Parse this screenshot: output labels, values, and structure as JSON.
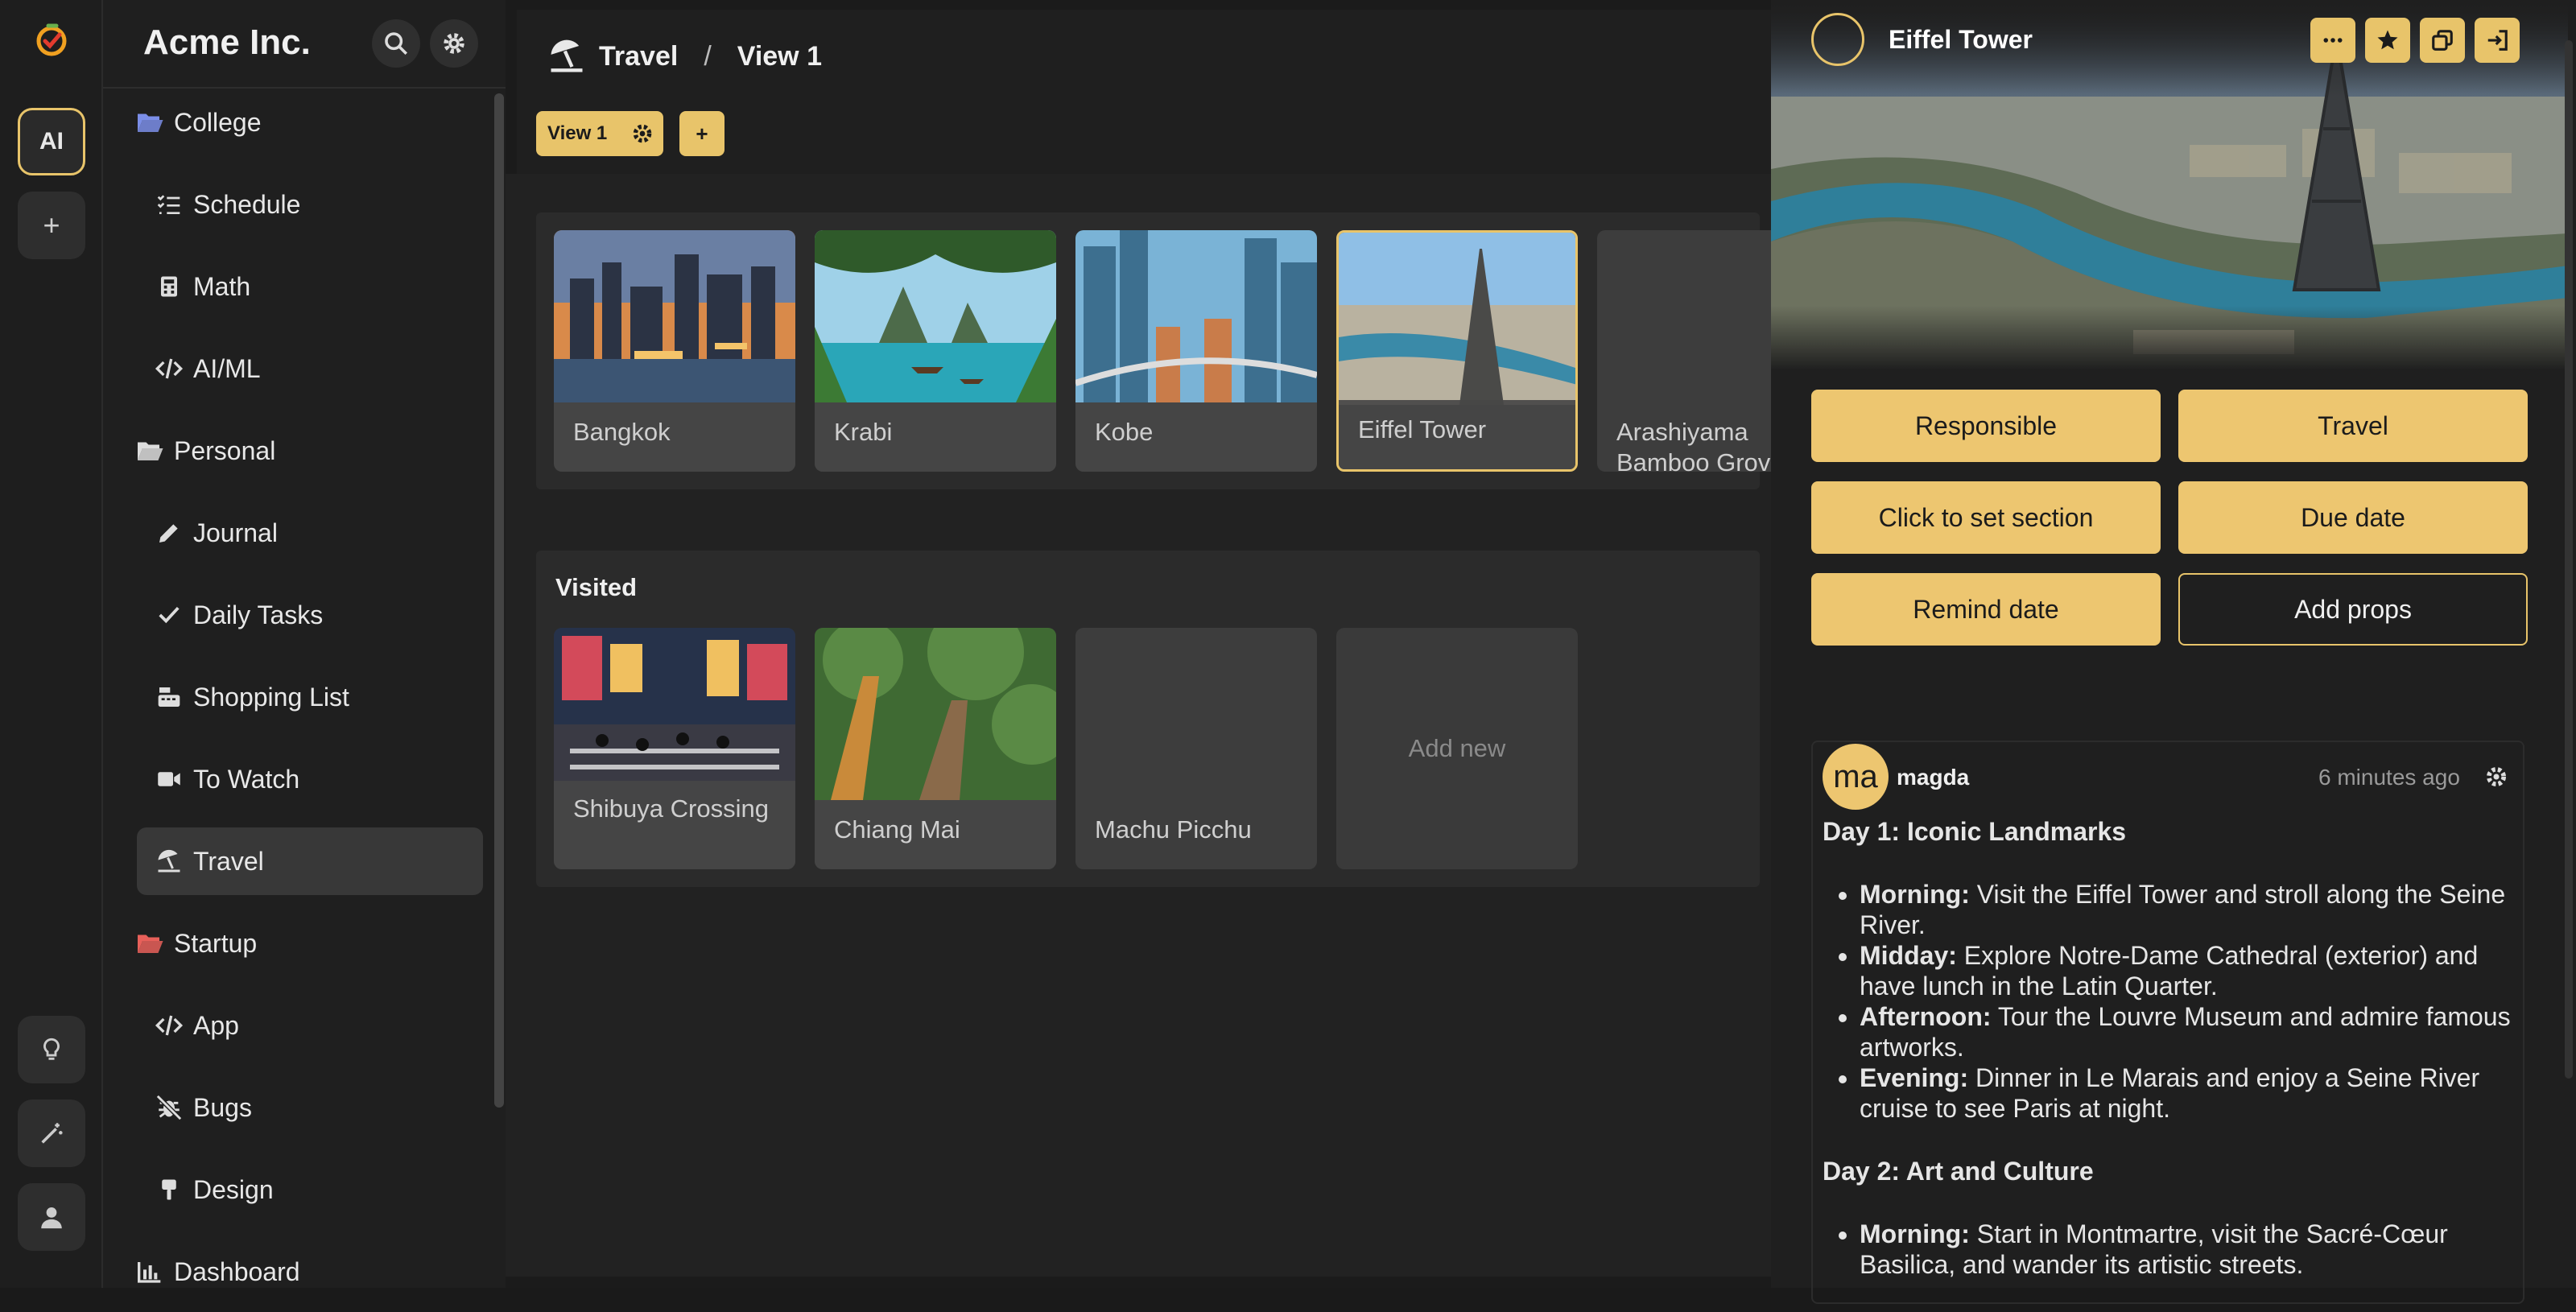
{
  "app": {
    "brand": "Acme Inc.",
    "ai_label": "AI",
    "plus_label": "+"
  },
  "sidebar": {
    "items": [
      {
        "label": "College",
        "icon": "folder-open-icon",
        "color": "#7b8ee8",
        "level": 0
      },
      {
        "label": "Schedule",
        "icon": "list-check-icon",
        "level": 1
      },
      {
        "label": "Math",
        "icon": "calculator-icon",
        "level": 1
      },
      {
        "label": "AI/ML",
        "icon": "code-icon",
        "level": 1
      },
      {
        "label": "Personal",
        "icon": "folder-open-icon",
        "color": "#dddddd",
        "level": 0
      },
      {
        "label": "Journal",
        "icon": "pencil-icon",
        "level": 1
      },
      {
        "label": "Daily Tasks",
        "icon": "check-icon",
        "level": 1
      },
      {
        "label": "Shopping List",
        "icon": "cash-register-icon",
        "level": 1
      },
      {
        "label": "To Watch",
        "icon": "video-icon",
        "level": 1
      },
      {
        "label": "Travel",
        "icon": "umbrella-beach-icon",
        "level": 1,
        "active": true
      },
      {
        "label": "Startup",
        "icon": "folder-open-icon",
        "color": "#e8605a",
        "level": 0
      },
      {
        "label": "App",
        "icon": "code-icon",
        "level": 1
      },
      {
        "label": "Bugs",
        "icon": "bug-slash-icon",
        "level": 1
      },
      {
        "label": "Design",
        "icon": "brush-icon",
        "level": 1
      },
      {
        "label": "Dashboard",
        "icon": "chart-icon",
        "level": 0
      }
    ]
  },
  "breadcrumb": {
    "page": "Travel",
    "separator": "/",
    "view": "View 1"
  },
  "views": {
    "active": "View 1",
    "add": "+"
  },
  "sections": [
    {
      "title": "",
      "cards": [
        {
          "label": "Bangkok",
          "image": true
        },
        {
          "label": "Krabi",
          "image": true
        },
        {
          "label": "Kobe",
          "image": true
        },
        {
          "label": "Eiffel Tower",
          "image": true,
          "selected": true
        },
        {
          "label": "Arashiyama Bamboo Grove",
          "image": false
        }
      ]
    },
    {
      "title": "Visited",
      "cards": [
        {
          "label": "Shibuya Crossing",
          "image": true
        },
        {
          "label": "Chiang Mai",
          "image": true
        },
        {
          "label": "Machu Picchu",
          "image": false
        }
      ],
      "add_new": "Add new"
    }
  ],
  "panel": {
    "title": "Eiffel Tower",
    "icons": [
      "more-icon",
      "star-icon",
      "duplicate-icon",
      "exit-icon"
    ],
    "buttons": [
      "Responsible",
      "Travel",
      "Click to set section",
      "Due date",
      "Remind date",
      "Add props"
    ],
    "comment": {
      "avatar": "ma",
      "author": "magda",
      "time": "6 minutes ago",
      "day1_title": "Day 1: Iconic Landmarks",
      "day1": [
        {
          "k": "Morning:",
          "v": " Visit the Eiffel Tower and stroll along the Seine River."
        },
        {
          "k": "Midday:",
          "v": " Explore Notre-Dame Cathedral (exterior) and have lunch in the Latin Quarter."
        },
        {
          "k": "Afternoon:",
          "v": " Tour the Louvre Museum and admire famous artworks."
        },
        {
          "k": "Evening:",
          "v": " Dinner in Le Marais and enjoy a Seine River cruise to see Paris at night."
        }
      ],
      "day2_title": "Day 2: Art and Culture",
      "day2": [
        {
          "k": "Morning:",
          "v": " Start in Montmartre, visit the Sacré-Cœur Basilica, and wander its artistic streets."
        }
      ]
    }
  },
  "colors": {
    "accent": "#e8c46a",
    "bg": "#1b1b1b"
  }
}
